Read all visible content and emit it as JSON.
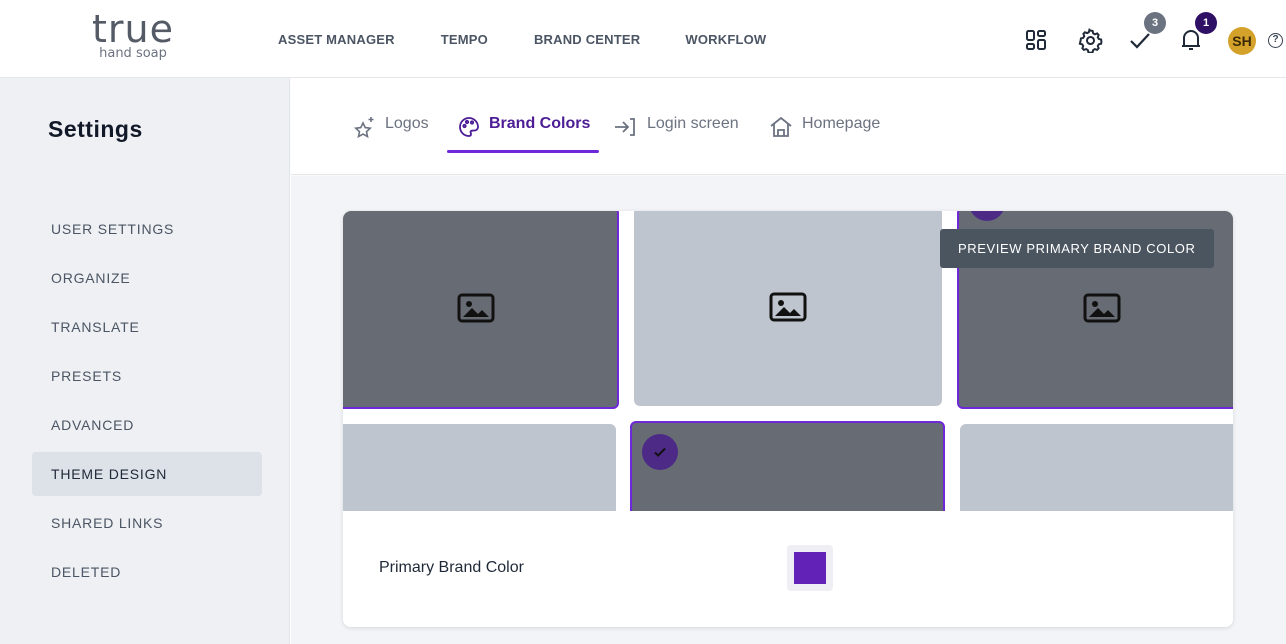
{
  "brand": {
    "name": "true",
    "tagline": "hand soap"
  },
  "top_nav": [
    "ASSET MANAGER",
    "TEMPO",
    "BRAND CENTER",
    "WORKFLOW"
  ],
  "header_icons": {
    "tasks_count": "3",
    "notifications_count": "1",
    "avatar_initials": "SH",
    "help": "?"
  },
  "sidebar": {
    "title": "Settings",
    "items": [
      {
        "label": "USER SETTINGS"
      },
      {
        "label": "ORGANIZE"
      },
      {
        "label": "TRANSLATE"
      },
      {
        "label": "PRESETS"
      },
      {
        "label": "ADVANCED"
      },
      {
        "label": "THEME DESIGN",
        "active": true
      },
      {
        "label": "SHARED LINKS"
      },
      {
        "label": "DELETED"
      }
    ]
  },
  "tabs": [
    {
      "label": "Logos",
      "icon": "sparkle-star-icon"
    },
    {
      "label": "Brand Colors",
      "icon": "palette-icon",
      "active": true
    },
    {
      "label": "Login screen",
      "icon": "login-arrow-icon"
    },
    {
      "label": "Homepage",
      "icon": "home-icon"
    }
  ],
  "preview": {
    "tooltip": "PREVIEW PRIMARY BRAND COLOR",
    "color_label": "Primary Brand Color",
    "primary_color": "#6222b8"
  },
  "colors": {
    "accent": "#6d28d9",
    "tile_dark": "#676c74",
    "tile_light": "#bfc5ce",
    "avatar": "#d4a22b",
    "badge_tasks": "#6b7280",
    "badge_notifications": "#2e1065"
  }
}
